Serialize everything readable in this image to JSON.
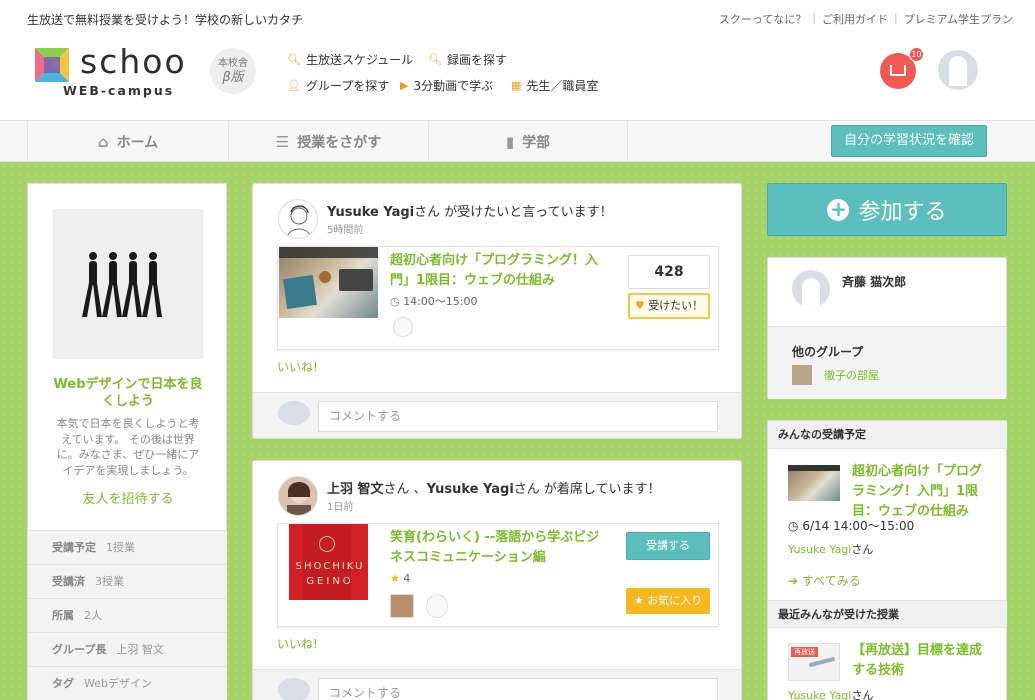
{
  "header": {
    "tagline": "生放送で無料授業を受けよう！学校の新しいカタチ",
    "top_links": [
      "スクーってなに？",
      "ご利用ガイド",
      "プレミアム学生プラン"
    ],
    "logo_text": "schoo",
    "logo_sub": "WEB-campus",
    "beta_line1": "本校舎",
    "beta_line2": "β版",
    "nav": [
      {
        "label": "生放送スケジュール",
        "icon": "search-icon"
      },
      {
        "label": "録画を探す",
        "icon": "search-icon"
      },
      {
        "label": "グループを探す",
        "icon": "person-icon"
      },
      {
        "label": "3分動画で学ぶ",
        "icon": "play-icon"
      },
      {
        "label": "先生／職員室",
        "icon": "building-icon"
      }
    ],
    "notification_count": "10"
  },
  "navbar": {
    "tabs": [
      {
        "label": "ホーム",
        "icon": "home-icon"
      },
      {
        "label": "授業をさがす",
        "icon": "list-icon"
      },
      {
        "label": "学部",
        "icon": "book-icon"
      }
    ],
    "progress_button": "自分の学習状況を確認"
  },
  "left": {
    "group_title": "Webデザインで日本を良くしよう",
    "group_desc": "本気で日本を良くしようと考えています。 その後は世界に。みなさま、ぜひ一緒にアイデアを実現しましょう。",
    "invite": "友人を招待する",
    "stats": [
      {
        "label": "受講予定",
        "value": "1授業"
      },
      {
        "label": "受講済",
        "value": "3授業"
      },
      {
        "label": "所属",
        "value": "2人"
      },
      {
        "label": "グループ長",
        "value": "上羽 智文"
      },
      {
        "label": "タグ",
        "value": "Webデザイン"
      }
    ]
  },
  "feed": [
    {
      "user": "Yusuke Yagi",
      "suffix": "さん が受けたいと言っています！",
      "time": "5時間前",
      "lesson_title": "超初心者向け「プログラミング！入門」1限目：ウェブの仕組み",
      "lesson_time": "14:00〜15:00",
      "want_count": "428",
      "want_label": "受けたい！",
      "like": "いいね!",
      "comment_placeholder": "コメントする"
    },
    {
      "user1": "上羽 智文",
      "mid": "さん 、",
      "user2": "Yusuke Yagi",
      "suffix": "さん が着席しています！",
      "time": "1日前",
      "lesson_title": "笑育(わらいく) --落語から学ぶビジネスコミュニケーション編",
      "rating": "4",
      "attend_label": "受講する",
      "fav_label": "お気に入り",
      "thumb_text1": "SHOCHIKU",
      "thumb_text2": "GEINO",
      "like": "いいね!",
      "comment_placeholder": "コメントする"
    }
  ],
  "right": {
    "join_label": "参加する",
    "member_name": "斉藤 猫次郎",
    "other_groups_title": "他のグループ",
    "other_group": "徹子の部屋",
    "schedule_title": "みんなの受講予定",
    "schedule_lesson": "超初心者向け「プログラミング！入門」1限目：ウェブの仕組み",
    "schedule_time": "6/14 14:00〜15:00",
    "schedule_user": "Yusuke Yagi",
    "schedule_user_suffix": "さん",
    "see_all": "すべてみる",
    "recent_title": "最近みんなが受けた授業",
    "recent_lesson": "【再放送】目標を達成する技術",
    "recent_user": "Yusuke Yagi",
    "recent_user_suffix": "さん",
    "recent_badge": "再放送"
  },
  "colors": {
    "accent_green": "#7cbc2c",
    "teal": "#5cbfbe",
    "bg_green": "#a6d46a",
    "notify_red": "#ef5a55",
    "fav_yellow": "#f5b820"
  }
}
